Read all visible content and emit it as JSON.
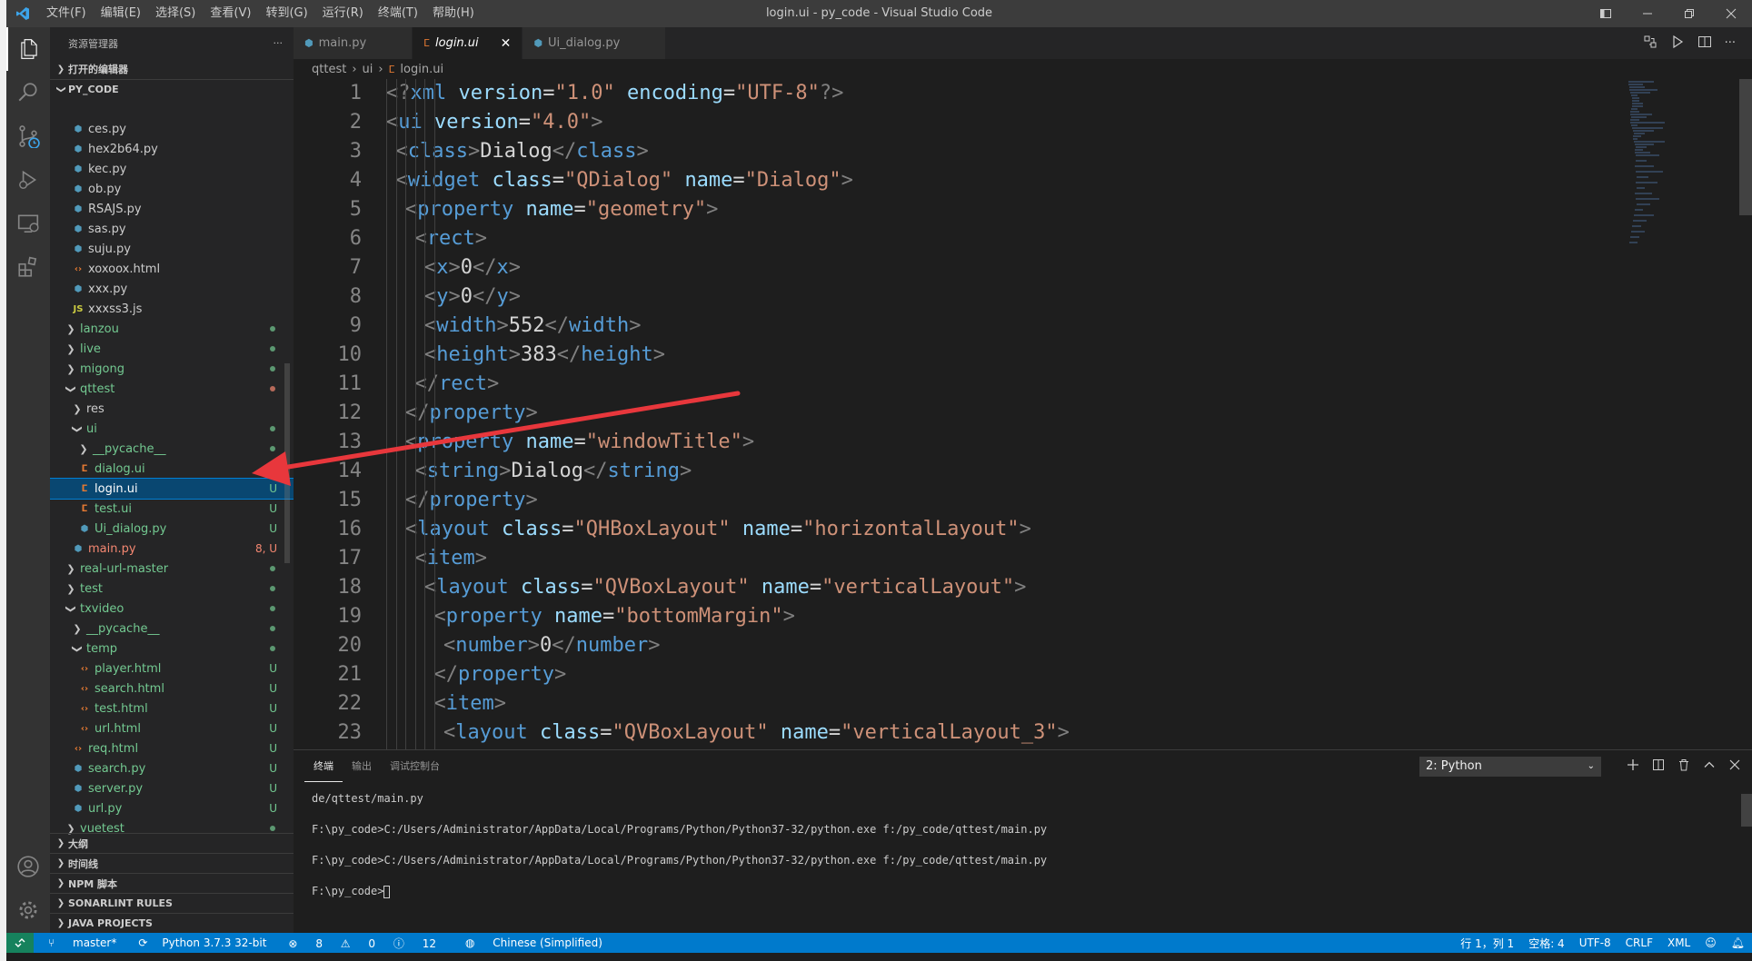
{
  "title_bar": {
    "menu": [
      "文件(F)",
      "编辑(E)",
      "选择(S)",
      "查看(V)",
      "转到(G)",
      "运行(R)",
      "终端(T)",
      "帮助(H)"
    ],
    "title": "login.ui - py_code - Visual Studio Code"
  },
  "sidebar": {
    "header": "资源管理器",
    "more": "···",
    "open_editors": "打开的编辑器",
    "root": "PY_CODE",
    "tree": [
      {
        "label": "ces.py",
        "indent": 1,
        "type": "py",
        "status": ""
      },
      {
        "label": "hex2b64.py",
        "indent": 1,
        "type": "py",
        "status": ""
      },
      {
        "label": "kec.py",
        "indent": 1,
        "type": "py",
        "status": ""
      },
      {
        "label": "ob.py",
        "indent": 1,
        "type": "py",
        "status": ""
      },
      {
        "label": "RSAJS.py",
        "indent": 1,
        "type": "py",
        "status": ""
      },
      {
        "label": "sas.py",
        "indent": 1,
        "type": "py",
        "status": ""
      },
      {
        "label": "suju.py",
        "indent": 1,
        "type": "py",
        "status": ""
      },
      {
        "label": "xoxoox.html",
        "indent": 1,
        "type": "html",
        "status": ""
      },
      {
        "label": "xxx.py",
        "indent": 1,
        "type": "py",
        "status": ""
      },
      {
        "label": "xxxss3.js",
        "indent": 1,
        "type": "js",
        "status": ""
      },
      {
        "label": "lanzou",
        "indent": 0,
        "type": "folder",
        "open": false,
        "status": "dot-green"
      },
      {
        "label": "live",
        "indent": 0,
        "type": "folder",
        "open": false,
        "status": "dot-green"
      },
      {
        "label": "migong",
        "indent": 0,
        "type": "folder",
        "open": false,
        "status": "dot-green"
      },
      {
        "label": "qttest",
        "indent": 0,
        "type": "folder",
        "open": true,
        "status": "dot-red"
      },
      {
        "label": "res",
        "indent": 1,
        "type": "folder",
        "open": false,
        "status": "",
        "color": "def"
      },
      {
        "label": "ui",
        "indent": 1,
        "type": "folder",
        "open": true,
        "status": "dot-green"
      },
      {
        "label": "__pycache__",
        "indent": 2,
        "type": "folder",
        "open": false,
        "status": "dot-green"
      },
      {
        "label": "dialog.ui",
        "indent": 2,
        "type": "rss",
        "status": "U"
      },
      {
        "label": "login.ui",
        "indent": 2,
        "type": "rss",
        "status": "U",
        "selected": true
      },
      {
        "label": "test.ui",
        "indent": 2,
        "type": "rss",
        "status": "U"
      },
      {
        "label": "Ui_dialog.py",
        "indent": 2,
        "type": "py",
        "status": "U"
      },
      {
        "label": "main.py",
        "indent": 1,
        "type": "py",
        "status": "8, U",
        "color": "red"
      },
      {
        "label": "real-url-master",
        "indent": 0,
        "type": "folder",
        "open": false,
        "status": "dot-green"
      },
      {
        "label": "test",
        "indent": 0,
        "type": "folder",
        "open": false,
        "status": "dot-green"
      },
      {
        "label": "txvideo",
        "indent": 0,
        "type": "folder",
        "open": true,
        "status": "dot-green"
      },
      {
        "label": "__pycache__",
        "indent": 1,
        "type": "folder",
        "open": false,
        "status": "dot-green"
      },
      {
        "label": "temp",
        "indent": 1,
        "type": "folder",
        "open": true,
        "status": "dot-green"
      },
      {
        "label": "player.html",
        "indent": 2,
        "type": "html",
        "status": "U"
      },
      {
        "label": "search.html",
        "indent": 2,
        "type": "html",
        "status": "U"
      },
      {
        "label": "test.html",
        "indent": 2,
        "type": "html",
        "status": "U"
      },
      {
        "label": "url.html",
        "indent": 2,
        "type": "html",
        "status": "U"
      },
      {
        "label": "req.html",
        "indent": 1,
        "type": "html",
        "status": "U"
      },
      {
        "label": "search.py",
        "indent": 1,
        "type": "py",
        "status": "U"
      },
      {
        "label": "server.py",
        "indent": 1,
        "type": "py",
        "status": "U"
      },
      {
        "label": "url.py",
        "indent": 1,
        "type": "py",
        "status": "U"
      },
      {
        "label": "vuetest",
        "indent": 0,
        "type": "folder",
        "open": false,
        "status": "dot-green"
      }
    ],
    "bottom_sections": [
      "大纲",
      "时间线",
      "NPM 脚本",
      "SONARLINT RULES",
      "JAVA PROJECTS"
    ]
  },
  "tabs": [
    {
      "label": "main.py",
      "type": "py",
      "active": false
    },
    {
      "label": "login.ui",
      "type": "rss",
      "active": true
    },
    {
      "label": "Ui_dialog.py",
      "type": "py",
      "active": false
    }
  ],
  "breadcrumb": [
    "qttest",
    "ui",
    "login.ui"
  ],
  "editor": {
    "line_numbers": [
      "1",
      "2",
      "3",
      "4",
      "5",
      "6",
      "7",
      "8",
      "9",
      "10",
      "11",
      "12",
      "13",
      "14",
      "15",
      "16",
      "17",
      "18",
      "19",
      "20",
      "21",
      "22",
      "23"
    ],
    "lines": [
      {
        "indent": 0,
        "tokens": [
          [
            "punct",
            "<?"
          ],
          [
            "tag",
            "xml"
          ],
          [
            "text",
            " "
          ],
          [
            "attr",
            "version"
          ],
          [
            "text",
            "="
          ],
          [
            "str",
            "\"1.0\""
          ],
          [
            "text",
            " "
          ],
          [
            "attr",
            "encoding"
          ],
          [
            "text",
            "="
          ],
          [
            "str",
            "\"UTF-8\""
          ],
          [
            "punct",
            "?>"
          ]
        ]
      },
      {
        "indent": 0,
        "tokens": [
          [
            "punct",
            "<"
          ],
          [
            "tag",
            "ui"
          ],
          [
            "text",
            " "
          ],
          [
            "attr",
            "version"
          ],
          [
            "text",
            "="
          ],
          [
            "str",
            "\"4.0\""
          ],
          [
            "punct",
            ">"
          ]
        ]
      },
      {
        "indent": 1,
        "tokens": [
          [
            "punct",
            "<"
          ],
          [
            "tag",
            "class"
          ],
          [
            "punct",
            ">"
          ],
          [
            "text",
            "Dialog"
          ],
          [
            "punct",
            "</"
          ],
          [
            "tag",
            "class"
          ],
          [
            "punct",
            ">"
          ]
        ]
      },
      {
        "indent": 1,
        "tokens": [
          [
            "punct",
            "<"
          ],
          [
            "tag",
            "widget"
          ],
          [
            "text",
            " "
          ],
          [
            "attr",
            "class"
          ],
          [
            "text",
            "="
          ],
          [
            "str",
            "\"QDialog\""
          ],
          [
            "text",
            " "
          ],
          [
            "attr",
            "name"
          ],
          [
            "text",
            "="
          ],
          [
            "str",
            "\"Dialog\""
          ],
          [
            "punct",
            ">"
          ]
        ]
      },
      {
        "indent": 2,
        "tokens": [
          [
            "punct",
            "<"
          ],
          [
            "tag",
            "property"
          ],
          [
            "text",
            " "
          ],
          [
            "attr",
            "name"
          ],
          [
            "text",
            "="
          ],
          [
            "str",
            "\"geometry\""
          ],
          [
            "punct",
            ">"
          ]
        ]
      },
      {
        "indent": 3,
        "tokens": [
          [
            "punct",
            "<"
          ],
          [
            "tag",
            "rect"
          ],
          [
            "punct",
            ">"
          ]
        ]
      },
      {
        "indent": 4,
        "tokens": [
          [
            "punct",
            "<"
          ],
          [
            "tag",
            "x"
          ],
          [
            "punct",
            ">"
          ],
          [
            "text",
            "0"
          ],
          [
            "punct",
            "</"
          ],
          [
            "tag",
            "x"
          ],
          [
            "punct",
            ">"
          ]
        ]
      },
      {
        "indent": 4,
        "tokens": [
          [
            "punct",
            "<"
          ],
          [
            "tag",
            "y"
          ],
          [
            "punct",
            ">"
          ],
          [
            "text",
            "0"
          ],
          [
            "punct",
            "</"
          ],
          [
            "tag",
            "y"
          ],
          [
            "punct",
            ">"
          ]
        ]
      },
      {
        "indent": 4,
        "tokens": [
          [
            "punct",
            "<"
          ],
          [
            "tag",
            "width"
          ],
          [
            "punct",
            ">"
          ],
          [
            "text",
            "552"
          ],
          [
            "punct",
            "</"
          ],
          [
            "tag",
            "width"
          ],
          [
            "punct",
            ">"
          ]
        ]
      },
      {
        "indent": 4,
        "tokens": [
          [
            "punct",
            "<"
          ],
          [
            "tag",
            "height"
          ],
          [
            "punct",
            ">"
          ],
          [
            "text",
            "383"
          ],
          [
            "punct",
            "</"
          ],
          [
            "tag",
            "height"
          ],
          [
            "punct",
            ">"
          ]
        ]
      },
      {
        "indent": 3,
        "tokens": [
          [
            "punct",
            "</"
          ],
          [
            "tag",
            "rect"
          ],
          [
            "punct",
            ">"
          ]
        ]
      },
      {
        "indent": 2,
        "tokens": [
          [
            "punct",
            "</"
          ],
          [
            "tag",
            "property"
          ],
          [
            "punct",
            ">"
          ]
        ]
      },
      {
        "indent": 2,
        "tokens": [
          [
            "punct",
            "<"
          ],
          [
            "tag",
            "property"
          ],
          [
            "text",
            " "
          ],
          [
            "attr",
            "name"
          ],
          [
            "text",
            "="
          ],
          [
            "str",
            "\"windowTitle\""
          ],
          [
            "punct",
            ">"
          ]
        ]
      },
      {
        "indent": 3,
        "tokens": [
          [
            "punct",
            "<"
          ],
          [
            "tag",
            "string"
          ],
          [
            "punct",
            ">"
          ],
          [
            "text",
            "Dialog"
          ],
          [
            "punct",
            "</"
          ],
          [
            "tag",
            "string"
          ],
          [
            "punct",
            ">"
          ]
        ]
      },
      {
        "indent": 2,
        "tokens": [
          [
            "punct",
            "</"
          ],
          [
            "tag",
            "property"
          ],
          [
            "punct",
            ">"
          ]
        ]
      },
      {
        "indent": 2,
        "tokens": [
          [
            "punct",
            "<"
          ],
          [
            "tag",
            "layout"
          ],
          [
            "text",
            " "
          ],
          [
            "attr",
            "class"
          ],
          [
            "text",
            "="
          ],
          [
            "str",
            "\"QHBoxLayout\""
          ],
          [
            "text",
            " "
          ],
          [
            "attr",
            "name"
          ],
          [
            "text",
            "="
          ],
          [
            "str",
            "\"horizontalLayout\""
          ],
          [
            "punct",
            ">"
          ]
        ]
      },
      {
        "indent": 3,
        "tokens": [
          [
            "punct",
            "<"
          ],
          [
            "tag",
            "item"
          ],
          [
            "punct",
            ">"
          ]
        ]
      },
      {
        "indent": 4,
        "tokens": [
          [
            "punct",
            "<"
          ],
          [
            "tag",
            "layout"
          ],
          [
            "text",
            " "
          ],
          [
            "attr",
            "class"
          ],
          [
            "text",
            "="
          ],
          [
            "str",
            "\"QVBoxLayout\""
          ],
          [
            "text",
            " "
          ],
          [
            "attr",
            "name"
          ],
          [
            "text",
            "="
          ],
          [
            "str",
            "\"verticalLayout\""
          ],
          [
            "punct",
            ">"
          ]
        ]
      },
      {
        "indent": 5,
        "tokens": [
          [
            "punct",
            "<"
          ],
          [
            "tag",
            "property"
          ],
          [
            "text",
            " "
          ],
          [
            "attr",
            "name"
          ],
          [
            "text",
            "="
          ],
          [
            "str",
            "\"bottomMargin\""
          ],
          [
            "punct",
            ">"
          ]
        ]
      },
      {
        "indent": 6,
        "tokens": [
          [
            "punct",
            "<"
          ],
          [
            "tag",
            "number"
          ],
          [
            "punct",
            ">"
          ],
          [
            "text",
            "0"
          ],
          [
            "punct",
            "</"
          ],
          [
            "tag",
            "number"
          ],
          [
            "punct",
            ">"
          ]
        ]
      },
      {
        "indent": 5,
        "tokens": [
          [
            "punct",
            "</"
          ],
          [
            "tag",
            "property"
          ],
          [
            "punct",
            ">"
          ]
        ]
      },
      {
        "indent": 5,
        "tokens": [
          [
            "punct",
            "<"
          ],
          [
            "tag",
            "item"
          ],
          [
            "punct",
            ">"
          ]
        ]
      },
      {
        "indent": 6,
        "tokens": [
          [
            "punct",
            "<"
          ],
          [
            "tag",
            "layout"
          ],
          [
            "text",
            " "
          ],
          [
            "attr",
            "class"
          ],
          [
            "text",
            "="
          ],
          [
            "str",
            "\"QVBoxLayout\""
          ],
          [
            "text",
            " "
          ],
          [
            "attr",
            "name"
          ],
          [
            "text",
            "="
          ],
          [
            "str",
            "\"verticalLayout_3\""
          ],
          [
            "punct",
            ">"
          ]
        ]
      }
    ]
  },
  "panel": {
    "tabs": [
      "终端",
      "输出",
      "调试控制台"
    ],
    "terminal_select": "2: Python",
    "terminal_lines": [
      "de/qttest/main.py",
      "F:\\py_code>C:/Users/Administrator/AppData/Local/Programs/Python/Python37-32/python.exe f:/py_code/qttest/main.py",
      "F:\\py_code>C:/Users/Administrator/AppData/Local/Programs/Python/Python37-32/python.exe f:/py_code/qttest/main.py",
      "F:\\py_code>"
    ]
  },
  "statusbar": {
    "branch": "master*",
    "python": "Python 3.7.3 32-bit",
    "errors": "8",
    "warnings": "0",
    "infos": "12",
    "language_pack": "Chinese (Simplified)",
    "position": "行 1，列 1",
    "spaces": "空格: 4",
    "encoding": "UTF-8",
    "eol": "CRLF",
    "language": "XML"
  },
  "colors": {
    "accent": "#007acc",
    "annotation_arrow": "#e8373c"
  }
}
